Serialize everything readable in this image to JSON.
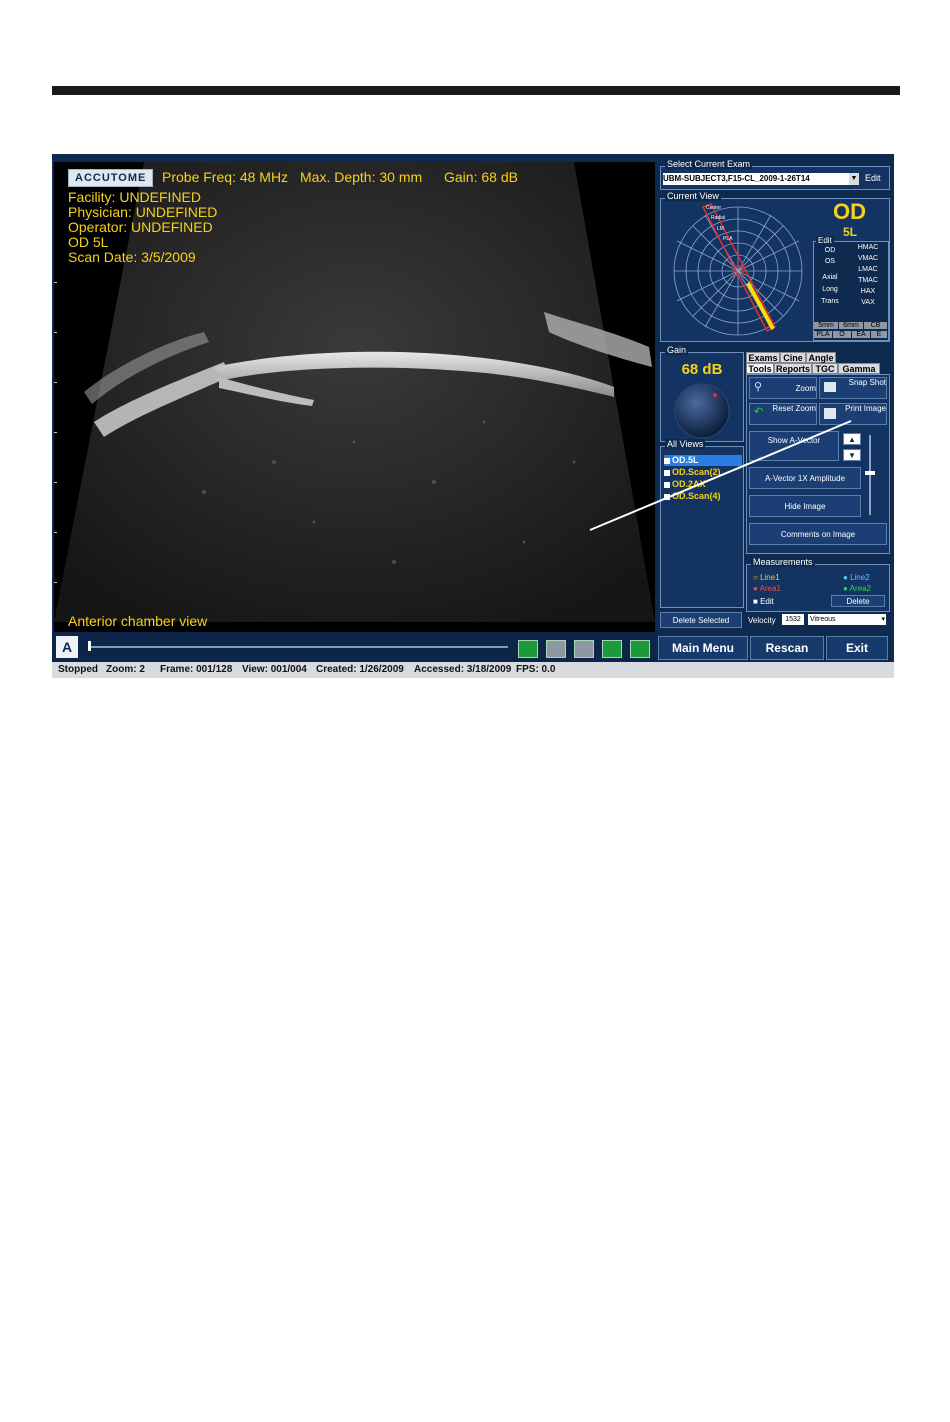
{
  "overlay": {
    "logo": "ACCUTOME",
    "probe_freq": "Probe Freq: 48 MHz",
    "max_depth": "Max. Depth: 30 mm",
    "gain": "Gain: 68 dB",
    "facility": "Facility: UNDEFINED",
    "physician": "Physician: UNDEFINED",
    "operator": "Operator: UNDEFINED",
    "eye_view": "OD  5L",
    "scan_date": "Scan Date: 3/5/2009",
    "caption": "Anterior chamber view"
  },
  "exam": {
    "title": "Select Current Exam",
    "value": "UBM-SUBJECT3,F15-CL_2009-1-26T14",
    "edit_label": "Edit"
  },
  "current_view": {
    "title": "Current View",
    "eye": "OD",
    "view": "5L",
    "edit_title": "Edit",
    "left_labels": [
      "OD",
      "OS",
      "Axial",
      "Long",
      "Trans"
    ],
    "right_labels": [
      "HMAC",
      "VMAC",
      "LMAC",
      "TMAC",
      "HAX",
      "VAX"
    ],
    "bottom_row1": [
      "5mm",
      "6mm",
      "CB"
    ],
    "bottom_row2": [
      "PLA",
      "O",
      "EA",
      "E"
    ],
    "dial_labels": [
      "Center",
      "Radial",
      "LM",
      "PLA"
    ]
  },
  "gain_panel": {
    "title": "Gain",
    "value": "68 dB"
  },
  "tabs": {
    "row1": [
      "Exams",
      "Cine",
      "Angle"
    ],
    "row2": [
      "Tools",
      "Reports",
      "TGC",
      "Gamma"
    ]
  },
  "tools": {
    "zoom": "Zoom",
    "snapshot": "Snap Shot",
    "reset_zoom": "Reset Zoom",
    "print_image": "Print Image",
    "show_avector": "Show A-Vector",
    "avector_amp": "A-Vector 1X Amplitude",
    "hide_image": "Hide Image",
    "comments": "Comments on Image"
  },
  "all_views": {
    "title": "All Views",
    "items": [
      "OD.5L",
      "OD.Scan(2)",
      "OD.2AX",
      "OD.Scan(4)"
    ],
    "delete_label": "Delete Selected"
  },
  "measurements": {
    "title": "Measurements",
    "line1": "Line1",
    "line2": "Line2",
    "area1": "Area1",
    "area2": "Area2",
    "edit": "Edit",
    "delete": "Delete",
    "velocity_label": "Velocity",
    "velocity_value": "1532",
    "medium": "Vitreous"
  },
  "nav": {
    "main_menu": "Main Menu",
    "rescan": "Rescan",
    "exit": "Exit"
  },
  "status": {
    "state": "Stopped",
    "zoom": "Zoom: 2",
    "frame": "Frame: 001/128",
    "view": "View: 001/004",
    "created": "Created: 1/26/2009",
    "accessed": "Accessed: 3/18/2009",
    "fps": "FPS: 0.0"
  },
  "colors": {
    "accent_yellow": "#f5d21a",
    "panel_blue": "#133463",
    "selection_blue": "#2a7de1",
    "play_green": "#1c9a3a"
  }
}
